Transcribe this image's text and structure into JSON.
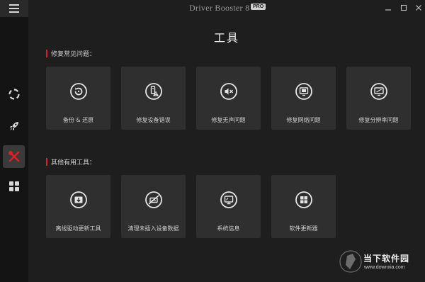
{
  "app": {
    "title": "Driver Booster 8",
    "badge": "PRO"
  },
  "window_controls": [
    {
      "name": "minimize-icon",
      "label": "minimize"
    },
    {
      "name": "maximize-icon",
      "label": "maximize"
    },
    {
      "name": "close-icon",
      "label": "close"
    }
  ],
  "sidebar": {
    "items": [
      {
        "name": "scan-icon",
        "active": false
      },
      {
        "name": "rocket-icon",
        "active": false
      },
      {
        "name": "tools-icon",
        "active": true
      },
      {
        "name": "apps-grid-icon",
        "active": false
      }
    ]
  },
  "main": {
    "title": "工具",
    "sections": [
      {
        "heading": "修复常见问题：",
        "tiles": [
          {
            "label": "备份 & 还原",
            "icon": "backup-restore-icon"
          },
          {
            "label": "修复设备错误",
            "icon": "device-error-icon"
          },
          {
            "label": "修复无声问题",
            "icon": "no-sound-icon"
          },
          {
            "label": "修复网络问题",
            "icon": "network-icon"
          },
          {
            "label": "修复分辨率问题",
            "icon": "resolution-icon"
          }
        ]
      },
      {
        "heading": "其他有用工具：",
        "tiles": [
          {
            "label": "离线驱动更新工具",
            "icon": "offline-update-icon"
          },
          {
            "label": "清理未插入设备数据",
            "icon": "clean-device-data-icon"
          },
          {
            "label": "系统信息",
            "icon": "system-info-icon"
          },
          {
            "label": "软件更新器",
            "icon": "software-updater-icon"
          }
        ]
      }
    ]
  },
  "watermark": {
    "text": "当下软件园",
    "url": "www.downxia.com"
  },
  "colors": {
    "accent": "#e02020",
    "tile_bg": "#2f2f2f",
    "window_bg": "#1e1e1e",
    "sidebar_bg": "#141414"
  }
}
